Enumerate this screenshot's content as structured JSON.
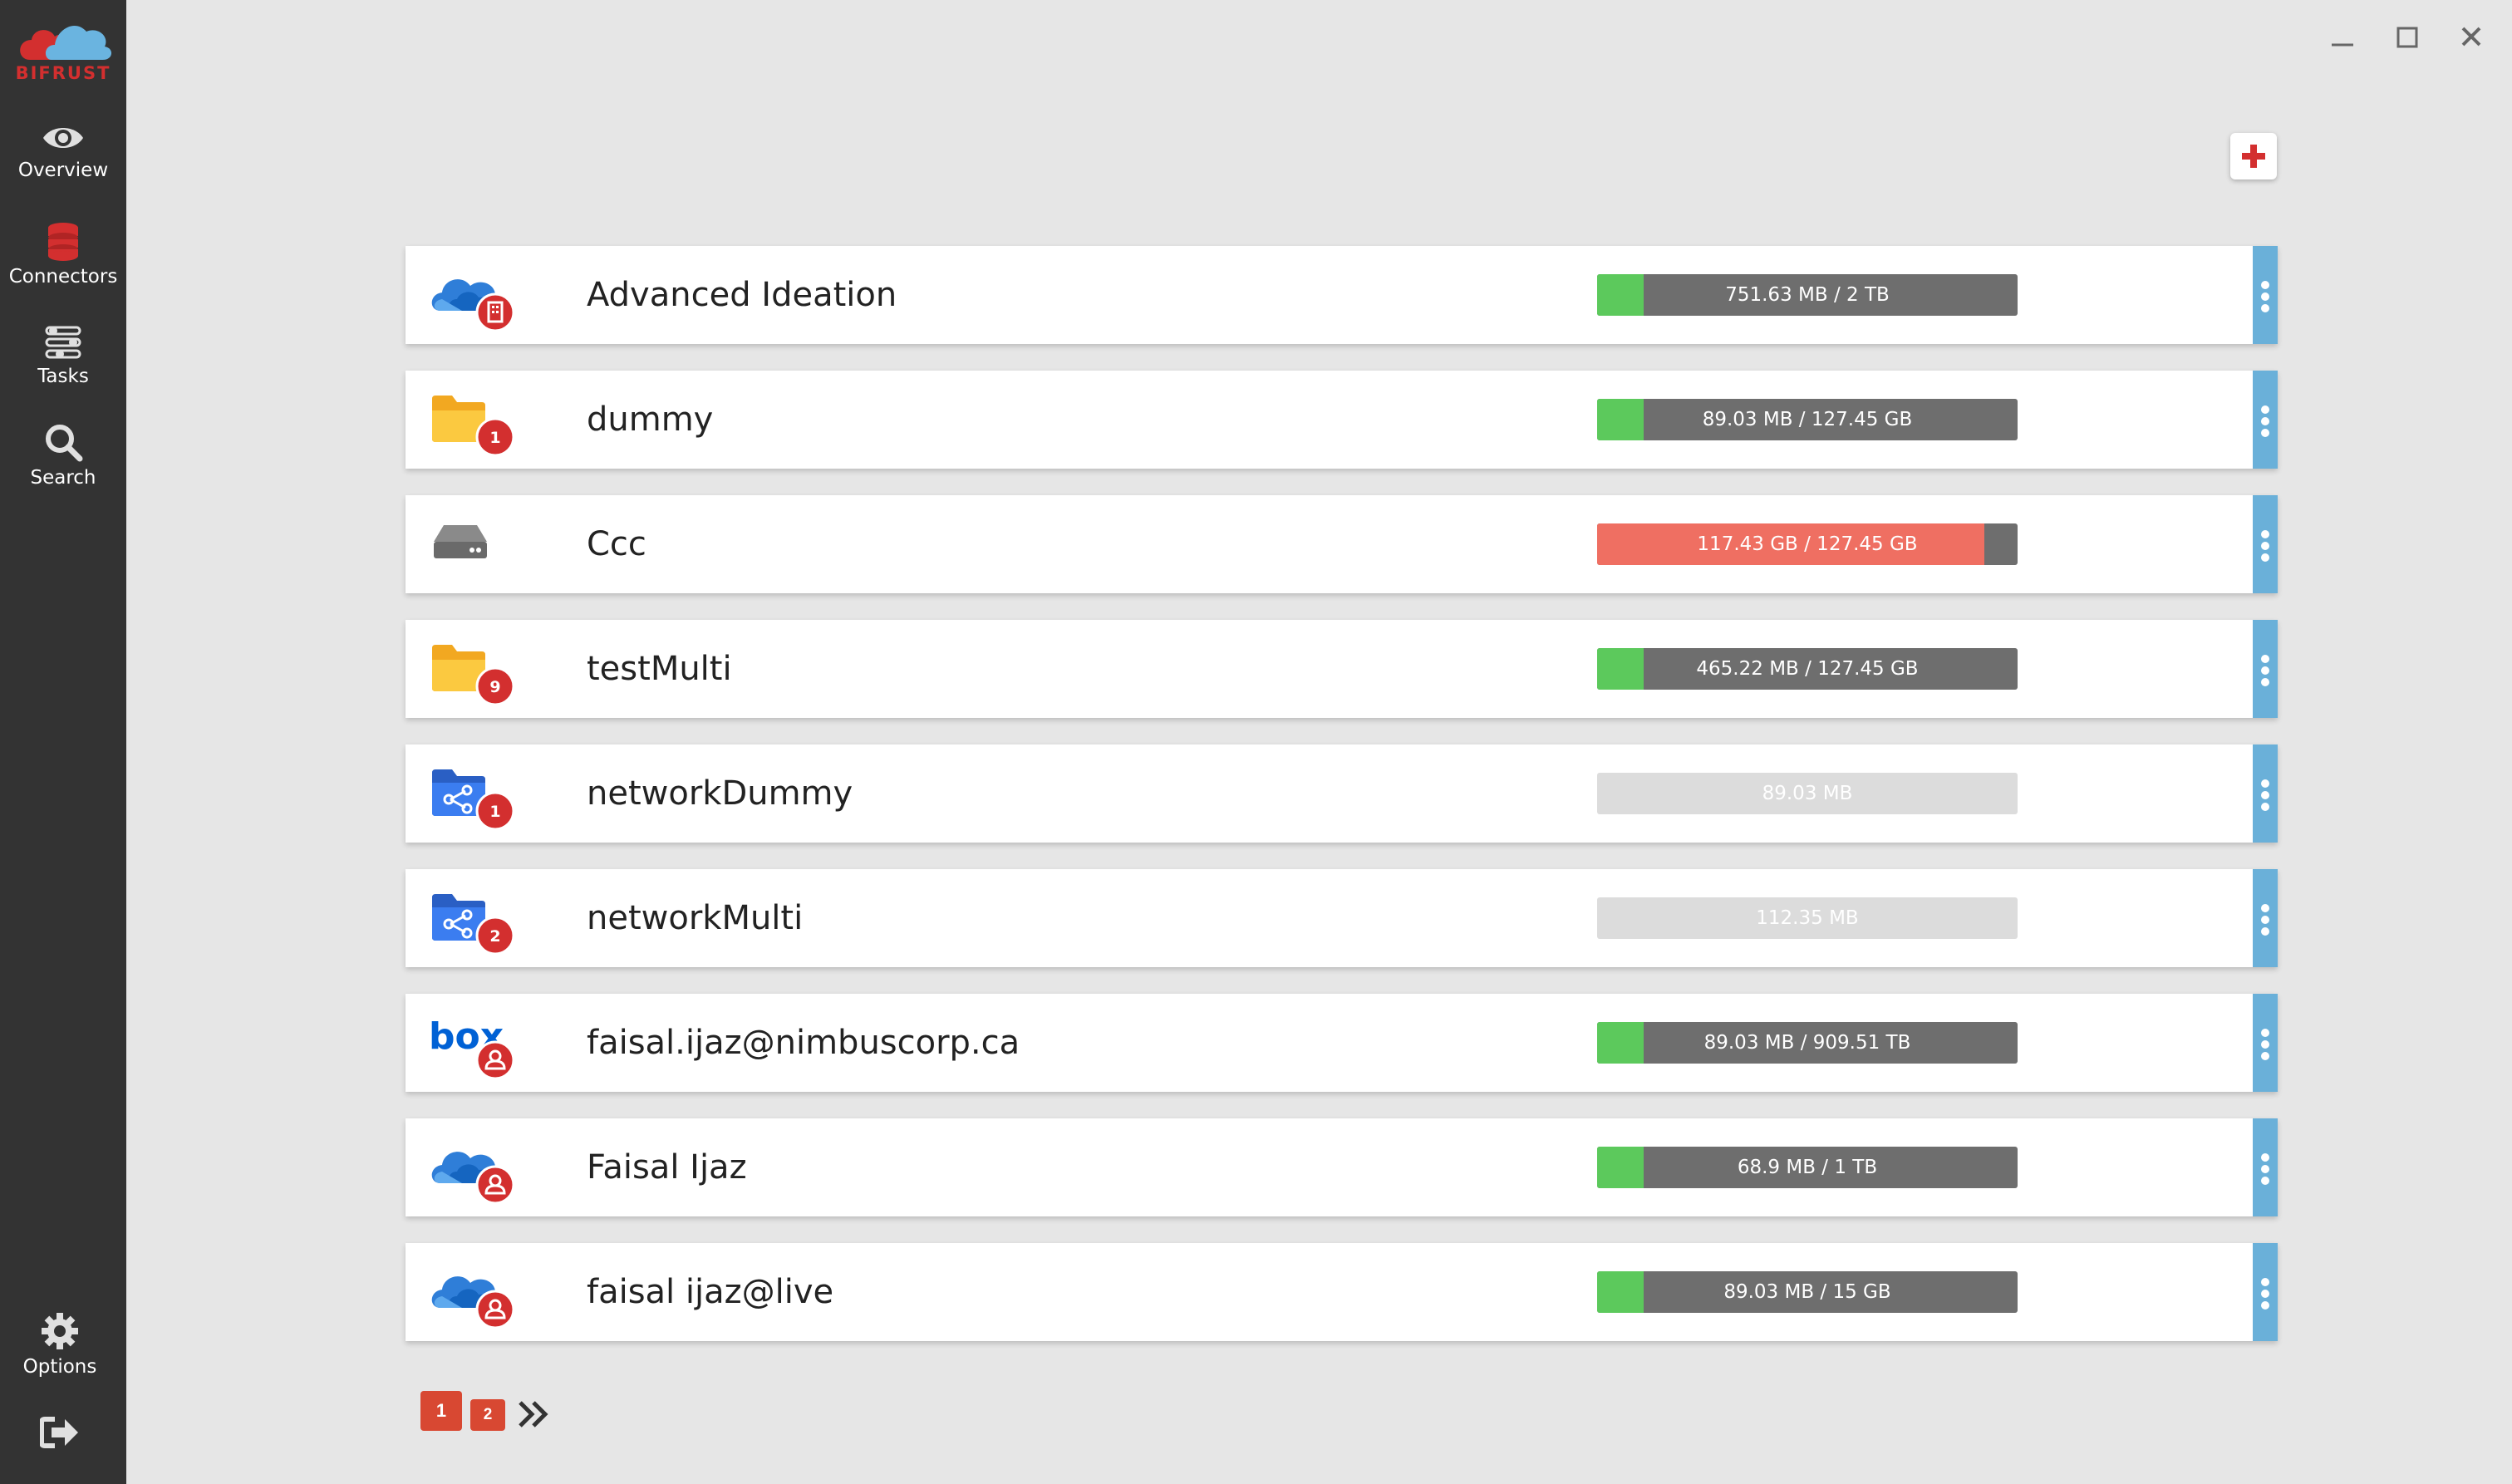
{
  "app": {
    "logo_text": "BIFRUST",
    "accent_color": "#d32f2f",
    "sidebar_color": "#333333"
  },
  "sidebar": {
    "items": [
      {
        "label": "Overview",
        "icon": "eye-icon"
      },
      {
        "label": "Connectors",
        "icon": "database-icon"
      },
      {
        "label": "Tasks",
        "icon": "tasks-icon"
      },
      {
        "label": "Search",
        "icon": "search-icon"
      }
    ],
    "bottom": [
      {
        "label": "Options",
        "icon": "gear-icon"
      },
      {
        "label": "",
        "icon": "logout-icon"
      }
    ]
  },
  "window_controls": [
    "minimize-icon",
    "maximize-icon",
    "close-icon"
  ],
  "add_button_icon": "plus-icon",
  "connectors": [
    {
      "name": "Advanced Ideation",
      "usage": "751.63 MB / 2 TB",
      "icon": "onedrive-cloud-icon",
      "badge": "building",
      "badge_text": "",
      "fill": 0.11,
      "fill_color": "#5cc95c",
      "has_quota": true
    },
    {
      "name": "dummy",
      "usage": "89.03 MB / 127.45 GB",
      "icon": "folder-icon",
      "badge": "number",
      "badge_text": "1",
      "fill": 0.11,
      "fill_color": "#5cc95c",
      "has_quota": true
    },
    {
      "name": "Ccc",
      "usage": "117.43 GB / 127.45 GB",
      "icon": "hard-drive-icon",
      "badge": "none",
      "badge_text": "",
      "fill": 0.921,
      "fill_color": "#ef6f62",
      "has_quota": true
    },
    {
      "name": "testMulti",
      "usage": "465.22 MB / 127.45 GB",
      "icon": "folder-icon",
      "badge": "number",
      "badge_text": "9",
      "fill": 0.11,
      "fill_color": "#5cc95c",
      "has_quota": true
    },
    {
      "name": "networkDummy",
      "usage": "89.03 MB",
      "icon": "network-folder-icon",
      "badge": "number",
      "badge_text": "1",
      "fill": 0,
      "fill_color": "#5cc95c",
      "has_quota": false
    },
    {
      "name": "networkMulti",
      "usage": "112.35 MB",
      "icon": "network-folder-icon",
      "badge": "number",
      "badge_text": "2",
      "fill": 0,
      "fill_color": "#5cc95c",
      "has_quota": false
    },
    {
      "name": "faisal.ijaz@nimbuscorp.ca",
      "usage": "89.03 MB / 909.51 TB",
      "icon": "box-logo-icon",
      "badge": "user",
      "badge_text": "",
      "fill": 0.11,
      "fill_color": "#5cc95c",
      "has_quota": true
    },
    {
      "name": "Faisal Ijaz",
      "usage": "68.9 MB / 1 TB",
      "icon": "onedrive-cloud-icon",
      "badge": "user",
      "badge_text": "",
      "fill": 0.11,
      "fill_color": "#5cc95c",
      "has_quota": true
    },
    {
      "name": "faisal ijaz@live",
      "usage": "89.03 MB / 15 GB",
      "icon": "onedrive-cloud-icon",
      "badge": "user",
      "badge_text": "",
      "fill": 0.11,
      "fill_color": "#5cc95c",
      "has_quota": true
    }
  ],
  "pagination": {
    "pages": [
      "1",
      "2"
    ],
    "current": "1",
    "next_icon": "double-chevron-right-icon"
  }
}
